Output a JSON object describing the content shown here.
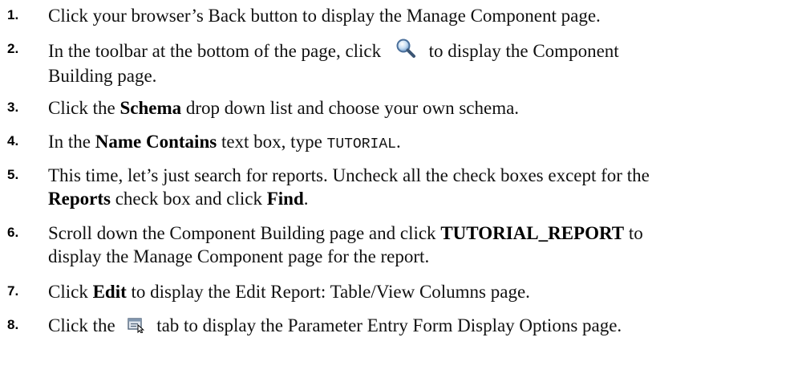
{
  "steps": [
    {
      "number": "1.",
      "text": "Click your browser’s Back button to display the Manage Component page."
    },
    {
      "number": "2.",
      "before": "In the toolbar at the bottom of the page, click",
      "icon": "magnifier-search-icon",
      "after": "to display the Component",
      "line2": "Building page."
    },
    {
      "number": "3.",
      "a": "Click the ",
      "b": "Schema",
      "c": " drop down list and choose your own schema."
    },
    {
      "number": "4.",
      "a": "In the ",
      "b": "Name Contains",
      "c": " text box, type ",
      "code": "TUTORIAL",
      "d": "."
    },
    {
      "number": "5.",
      "line1": "This time, let’s just search for reports. Uncheck all the check boxes except for the",
      "b1": "Reports",
      "mid": " check box and click ",
      "b2": "Find",
      "end": "."
    },
    {
      "number": "6.",
      "a": "Scroll down the Component Building page and click ",
      "b": "TUTORIAL_REPORT",
      "c": " to",
      "line2": "display the Manage Component page for the report."
    },
    {
      "number": "7.",
      "a": "Click ",
      "b": "Edit",
      "c": " to display the Edit Report: Table/View Columns page."
    },
    {
      "number": "8.",
      "before": "Click the",
      "icon": "parameter-form-tab-icon",
      "after": "tab to display the Parameter Entry Form Display Options page."
    }
  ]
}
